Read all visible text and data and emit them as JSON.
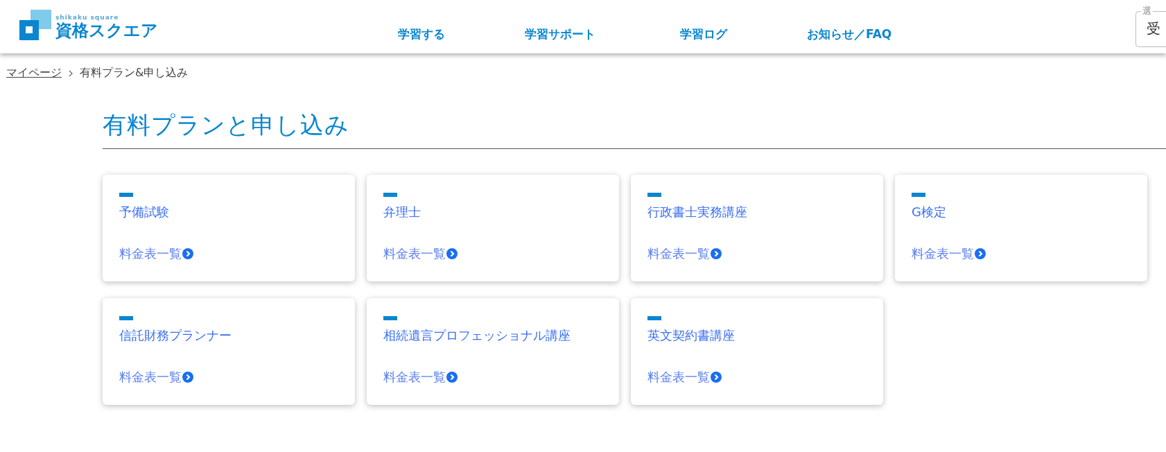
{
  "header": {
    "logo_sub": "shikaku square",
    "logo": "資格スクエア",
    "nav": [
      "学習する",
      "学習サポート",
      "学習ログ",
      "お知らせ／FAQ"
    ],
    "select": {
      "label": "選",
      "value": "受"
    }
  },
  "breadcrumb": [
    {
      "text": "マイページ",
      "kind": "link"
    },
    {
      "text": "有料プラン&申し込み",
      "kind": "current"
    }
  ],
  "title": "有料プランと申し込み",
  "courses": [
    {
      "name": "予備試験",
      "link": "料金表一覧"
    },
    {
      "name": "弁理士",
      "link": "料金表一覧"
    },
    {
      "name": "行政書士実務講座",
      "link": "料金表一覧"
    },
    {
      "name": "G検定",
      "link": "料金表一覧"
    },
    {
      "name": "信託財務プランナー",
      "link": "料金表一覧"
    },
    {
      "name": "相続遺言プロフェッショナル講座",
      "link": "料金表一覧"
    },
    {
      "name": "英文契約書講座",
      "link": "料金表一覧"
    }
  ]
}
